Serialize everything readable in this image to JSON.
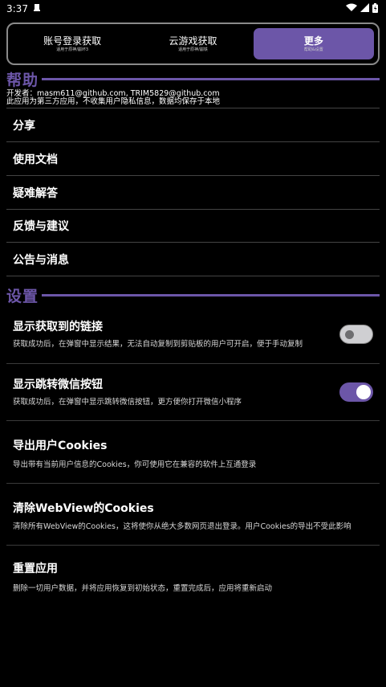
{
  "status": {
    "time": "3:37"
  },
  "tabs": [
    {
      "label": "账号登录获取",
      "sub": "适用于原神/崩坏3"
    },
    {
      "label": "云游戏获取",
      "sub": "适用于原神/崩铁"
    },
    {
      "label": "更多",
      "sub": "帮助&设置"
    }
  ],
  "help": {
    "title": "帮助",
    "developer": "开发者：masm611@github.com, TRIM5829@github.com",
    "privacy": "此应用为第三方应用，不收集用户隐私信息，数据均保存于本地",
    "items": [
      "分享",
      "使用文档",
      "疑难解答",
      "反馈与建议",
      "公告与消息"
    ]
  },
  "settings": {
    "title": "设置",
    "items": [
      {
        "title": "显示获取到的链接",
        "desc": "获取成功后，在弹窗中显示结果，无法自动复制到剪贴板的用户可开启，便于手动复制",
        "toggle": "off"
      },
      {
        "title": "显示跳转微信按钮",
        "desc": "获取成功后，在弹窗中显示跳转微信按钮，更方便你打开微信小程序",
        "toggle": "on"
      },
      {
        "title": "导出用户Cookies",
        "desc": "导出带有当前用户信息的Cookies，你可使用它在兼容的软件上互通登录"
      },
      {
        "title": "清除WebView的Cookies",
        "desc": "清除所有WebView的Cookies，这将使你从绝大多数网页退出登录。用户Cookies的导出不受此影响"
      },
      {
        "title": "重置应用",
        "desc": "删除一切用户数据，并将应用恢复到初始状态，重置完成后，应用将重新启动"
      }
    ]
  },
  "colors": {
    "accent": "#6c56a8",
    "background": "#000000"
  }
}
